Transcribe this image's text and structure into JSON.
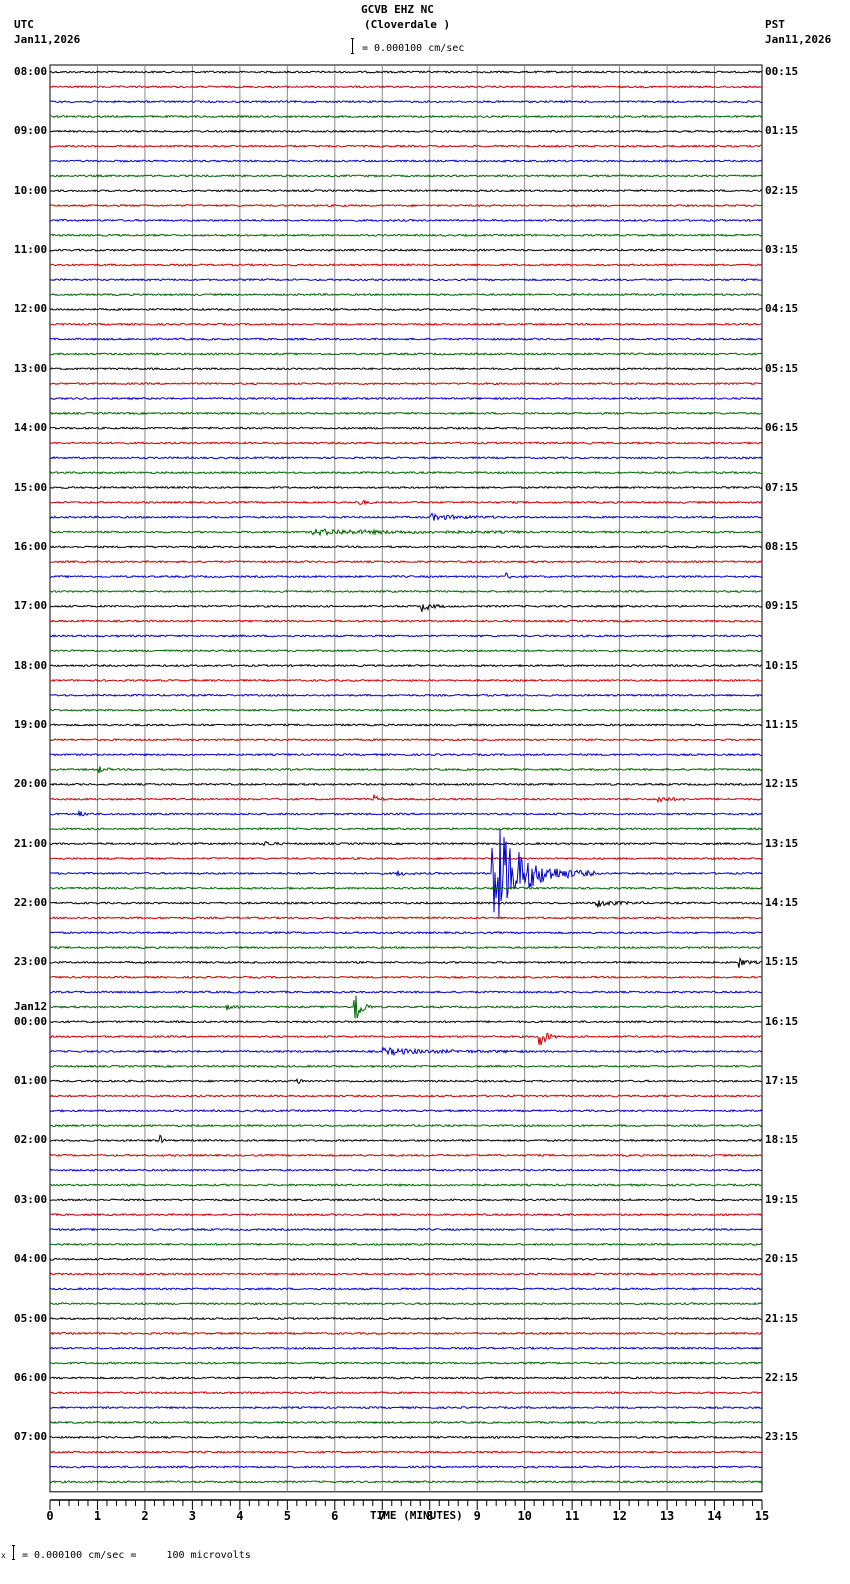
{
  "header": {
    "station": "GCVB EHZ NC",
    "location": "(Cloverdale )",
    "left_tz": "UTC",
    "left_date": "Jan11,2026",
    "right_tz": "PST",
    "right_date": "Jan11,2026",
    "scale_label": "= 0.000100 cm/sec"
  },
  "footer": {
    "scale_label": "= 0.000100 cm/sec =     100 microvolts",
    "prefix": "x"
  },
  "chart_data": {
    "type": "line",
    "title": "GCVB EHZ NC (Cloverdale )",
    "xlabel": "TIME (MINUTES)",
    "xlim": [
      0,
      15
    ],
    "x_ticks": [
      "0",
      "1",
      "2",
      "3",
      "4",
      "5",
      "6",
      "7",
      "8",
      "9",
      "10",
      "11",
      "12",
      "13",
      "14",
      "15"
    ],
    "trace_count": 96,
    "minutes_per_trace": 15,
    "trace_colors": [
      "#000000",
      "#cc0000",
      "#0000cc",
      "#006600"
    ],
    "utc_labels": [
      "08:00",
      "09:00",
      "10:00",
      "11:00",
      "12:00",
      "13:00",
      "14:00",
      "15:00",
      "16:00",
      "17:00",
      "18:00",
      "19:00",
      "20:00",
      "21:00",
      "22:00",
      "23:00",
      "00:00",
      "01:00",
      "02:00",
      "03:00",
      "04:00",
      "05:00",
      "06:00",
      "07:00"
    ],
    "date_change_label": "Jan12",
    "pst_labels": [
      "00:15",
      "01:15",
      "02:15",
      "03:15",
      "04:15",
      "05:15",
      "06:15",
      "07:15",
      "08:15",
      "09:15",
      "10:15",
      "11:15",
      "12:15",
      "13:15",
      "14:15",
      "15:15",
      "16:15",
      "17:15",
      "18:15",
      "19:15",
      "20:15",
      "21:15",
      "22:15",
      "23:15"
    ],
    "events": [
      {
        "trace": 29,
        "minute": 6.5,
        "duration": 0.3,
        "amplitude": 4
      },
      {
        "trace": 30,
        "minute": 8.0,
        "duration": 1.5,
        "amplitude": 3
      },
      {
        "trace": 31,
        "minute": 5.5,
        "duration": 4.5,
        "amplitude": 2.5
      },
      {
        "trace": 34,
        "minute": 9.6,
        "duration": 0.3,
        "amplitude": 3
      },
      {
        "trace": 36,
        "minute": 7.8,
        "duration": 0.6,
        "amplitude": 6
      },
      {
        "trace": 47,
        "minute": 1.0,
        "duration": 0.3,
        "amplitude": 5
      },
      {
        "trace": 49,
        "minute": 6.8,
        "duration": 0.3,
        "amplitude": 5
      },
      {
        "trace": 49,
        "minute": 12.8,
        "duration": 0.6,
        "amplitude": 4
      },
      {
        "trace": 50,
        "minute": 0.6,
        "duration": 0.3,
        "amplitude": 3
      },
      {
        "trace": 52,
        "minute": 4.5,
        "duration": 0.4,
        "amplitude": 3
      },
      {
        "trace": 54,
        "minute": 7.3,
        "duration": 0.4,
        "amplitude": 3
      },
      {
        "trace": 54,
        "minute": 9.3,
        "duration": 2.2,
        "amplitude": 60
      },
      {
        "trace": 56,
        "minute": 11.5,
        "duration": 1.0,
        "amplitude": 4
      },
      {
        "trace": 60,
        "minute": 14.5,
        "duration": 0.4,
        "amplitude": 6
      },
      {
        "trace": 63,
        "minute": 6.4,
        "duration": 0.4,
        "amplitude": 30
      },
      {
        "trace": 63,
        "minute": 3.7,
        "duration": 0.3,
        "amplitude": 3
      },
      {
        "trace": 65,
        "minute": 10.3,
        "duration": 0.4,
        "amplitude": 16
      },
      {
        "trace": 66,
        "minute": 7.0,
        "duration": 3.0,
        "amplitude": 3
      },
      {
        "trace": 68,
        "minute": 5.2,
        "duration": 0.2,
        "amplitude": 5
      },
      {
        "trace": 72,
        "minute": 2.3,
        "duration": 0.2,
        "amplitude": 7
      }
    ]
  }
}
